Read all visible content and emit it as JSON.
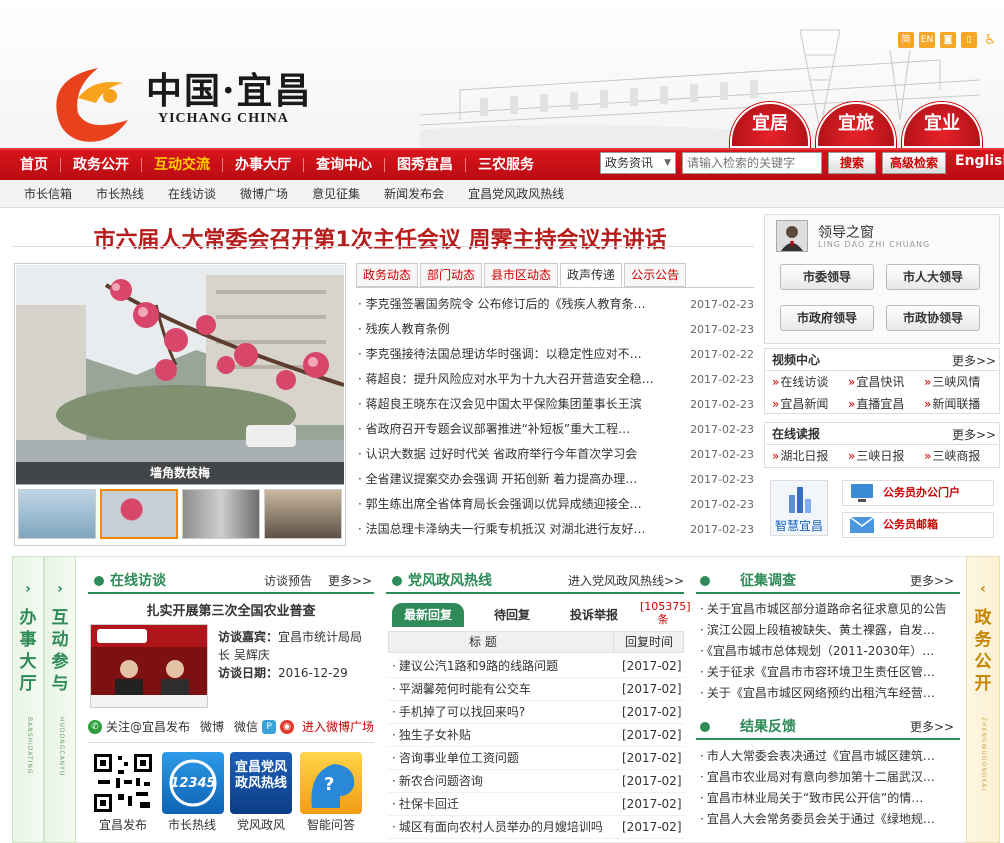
{
  "header": {
    "logo_cn": "中国·宜昌",
    "logo_en": "YICHANG CHINA",
    "tools": [
      "简",
      "EN",
      "RSS",
      "手机",
      "无障碍"
    ],
    "spheres": [
      "宜居",
      "宜旅",
      "宜业"
    ]
  },
  "nav": {
    "items": [
      {
        "label": "首页",
        "active": false
      },
      {
        "label": "政务公开",
        "active": false
      },
      {
        "label": "互动交流",
        "active": true
      },
      {
        "label": "办事大厅",
        "active": false
      },
      {
        "label": "查询中心",
        "active": false
      },
      {
        "label": "图秀宜昌",
        "active": false
      },
      {
        "label": "三农服务",
        "active": false
      }
    ],
    "search_select": "政务资讯",
    "search_placeholder": "请输入检索的关键字",
    "search_button": "搜索",
    "advanced_button": "高级检索",
    "english": "English"
  },
  "subnav": [
    "市长信箱",
    "市长热线",
    "在线访谈",
    "微博广场",
    "意见征集",
    "新闻发布会",
    "宜昌党风政风热线"
  ],
  "headline": "市六届人大常委会召开第1次主任会议 周霁主持会议并讲话",
  "photo": {
    "caption": "墙角数枝梅"
  },
  "news": {
    "tabs": [
      {
        "label": "政务动态",
        "active": false
      },
      {
        "label": "部门动态",
        "active": false
      },
      {
        "label": "县市区动态",
        "active": false
      },
      {
        "label": "政声传递",
        "active": true
      },
      {
        "label": "公示公告",
        "active": false
      }
    ],
    "items": [
      {
        "title": "李克强签署国务院令 公布修订后的《残疾人教育条…",
        "date": "2017-02-23"
      },
      {
        "title": "残疾人教育条例",
        "date": "2017-02-23"
      },
      {
        "title": "李克强接待法国总理访华时强调：以稳定性应对不…",
        "date": "2017-02-22"
      },
      {
        "title": "蒋超良：提升风险应对水平为十九大召开营造安全稳…",
        "date": "2017-02-23"
      },
      {
        "title": "蒋超良王晓东在汉会见中国太平保险集团董事长王滨",
        "date": "2017-02-23"
      },
      {
        "title": "省政府召开专题会议部署推进“补短板”重大工程…",
        "date": "2017-02-23"
      },
      {
        "title": "认识大数据 过好时代关 省政府举行今年首次学习会",
        "date": "2017-02-23"
      },
      {
        "title": "全省建议提案交办会强调 开拓创新 着力提高办理…",
        "date": "2017-02-23"
      },
      {
        "title": "郭生练出席全省体育局长会强调以优异成绩迎接全…",
        "date": "2017-02-23"
      },
      {
        "title": "法国总理卡泽纳夫一行乘专机抵汉 对湖北进行友好…",
        "date": "2017-02-23"
      }
    ]
  },
  "leader": {
    "title": "领导之窗",
    "subtitle": "LING DAO ZHI CHUANG",
    "buttons": [
      "市委领导",
      "市人大领导",
      "市政府领导",
      "市政协领导"
    ]
  },
  "video": {
    "title": "视频中心",
    "more": "更多>>",
    "links": [
      "在线访谈",
      "宜昌快讯",
      "三峡风情",
      "宜昌新闻",
      "直播宜昌",
      "新闻联播"
    ]
  },
  "reading": {
    "title": "在线读报",
    "more": "更多>>",
    "links": [
      "湖北日报",
      "三峡日报",
      "三峡商报"
    ]
  },
  "services": {
    "zhihui": "智慧宜昌",
    "mail1": "公务员办公门户",
    "mail2": "公务员邮箱"
  },
  "sides": {
    "left1": {
      "text": "办事大厅",
      "en": "BANSHIDATING"
    },
    "left2": {
      "text": "互动参与",
      "en": "HUDONGCANYU"
    },
    "right": {
      "text": "政务公开",
      "en": "ZHENGWUGONGKAI"
    }
  },
  "interview": {
    "title": "在线访谈",
    "preview": "访谈预告",
    "more": "更多>>",
    "topic": "扎实开展第三次全国农业普查",
    "guest_label": "访谈嘉宾：",
    "guest": "宜昌市统计局局长 吴辉庆",
    "date_label": "访谈日期：",
    "date": "2016-12-29",
    "weibo_follow": "关注@宜昌发布",
    "weibo": "微博",
    "wechat": "微信",
    "weibo_square": "进入微博广场",
    "tiles": [
      "宜昌发布",
      "市长热线",
      "党风政风",
      "智能问答"
    ],
    "tile_text_12345": "12345",
    "tile_text_dfzf": "宜昌党风政风热线"
  },
  "hotline": {
    "title": "党风政风热线",
    "enter": "进入党风政风热线>>",
    "tabs": [
      "最新回复",
      "待回复",
      "投诉举报"
    ],
    "count": "[105375]条",
    "col_title": "标 题",
    "col_date": "回复时间",
    "rows": [
      {
        "title": "建议公汽1路和9路的线路问题",
        "date": "[2017-02]"
      },
      {
        "title": "平湖馨苑何时能有公交车",
        "date": "[2017-02]"
      },
      {
        "title": "手机掉了可以找回来吗?",
        "date": "[2017-02]"
      },
      {
        "title": "独生子女补贴",
        "date": "[2017-02]"
      },
      {
        "title": "咨询事业单位工资问题",
        "date": "[2017-02]"
      },
      {
        "title": "新农合问题咨询",
        "date": "[2017-02]"
      },
      {
        "title": "社保卡回迁",
        "date": "[2017-02]"
      },
      {
        "title": "城区有面向农村人员举办的月嫂培训吗",
        "date": "[2017-02]"
      }
    ]
  },
  "survey": {
    "title": "征集调查",
    "more": "更多>>",
    "items": [
      "关于宜昌市城区部分道路命名征求意见的公告",
      "滨江公园上段植被缺失、黄土裸露，自发…",
      "《宜昌市城市总体规划（2011-2030年）…",
      "关于征求《宜昌市市容环境卫生责任区管…",
      "关于《宜昌市城区网络预约出租汽车经营…"
    ]
  },
  "feedback": {
    "title": "结果反馈",
    "more": "更多>>",
    "items": [
      "市人大常委会表决通过《宜昌市城区建筑…",
      "宜昌市农业局对有意向参加第十二届武汉…",
      "宜昌市林业局关于“致市民公开信”的情…",
      "宜昌人大会常务委员会关于通过《绿地规…"
    ]
  }
}
